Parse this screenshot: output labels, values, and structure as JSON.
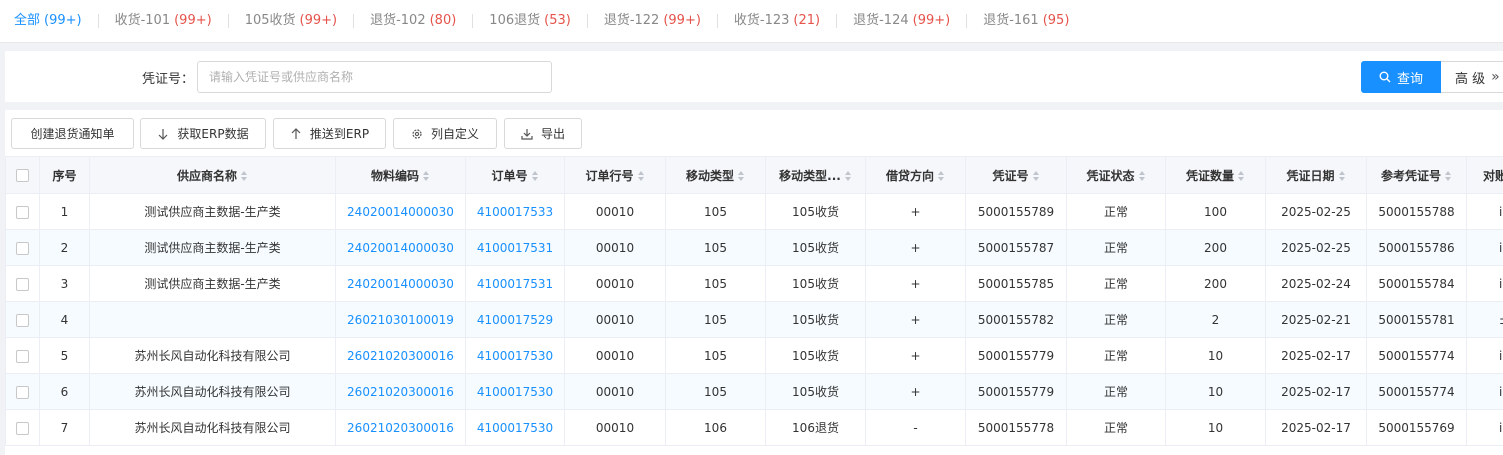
{
  "tabs": [
    {
      "label": "全部",
      "count": "(99+)",
      "active": true
    },
    {
      "label": "收货-101",
      "count": "(99+)"
    },
    {
      "label": "105收货",
      "count": "(99+)"
    },
    {
      "label": "退货-102",
      "count": "(80)"
    },
    {
      "label": "106退货",
      "count": "(53)"
    },
    {
      "label": "退货-122",
      "count": "(99+)"
    },
    {
      "label": "收货-123",
      "count": "(21)"
    },
    {
      "label": "退货-124",
      "count": "(99+)"
    },
    {
      "label": "退货-161",
      "count": "(95)"
    }
  ],
  "search": {
    "label": "凭证号：",
    "placeholder": "请输入凭证号或供应商名称",
    "value": "",
    "query_label": "查询",
    "advanced_label": "高 级",
    "advanced_chevron": "»"
  },
  "toolbar": {
    "create_label": "创建退货通知单",
    "fetch_label": "获取ERP数据",
    "push_label": "推送到ERP",
    "columns_label": "列自定义",
    "export_label": "导出"
  },
  "table": {
    "headers": {
      "index": "序号",
      "supplier": "供应商名称",
      "material": "物料编码",
      "order": "订单号",
      "order_line": "订单行号",
      "move_type": "移动类型",
      "move_type_desc": "移动类型...",
      "direction": "借贷方向",
      "voucher": "凭证号",
      "voucher_status": "凭证状态",
      "voucher_qty": "凭证数量",
      "voucher_date": "凭证日期",
      "ref_voucher": "参考凭证号",
      "last": "对账"
    },
    "rows": [
      {
        "index": "1",
        "supplier": "测试供应商主数据-生产类",
        "material": "24020014000030",
        "order": "4100017533",
        "order_line": "00010",
        "move_type": "105",
        "move_type_desc": "105收货",
        "direction": "+",
        "voucher": "5000155789",
        "voucher_status": "正常",
        "voucher_qty": "100",
        "voucher_date": "2025-02-25",
        "ref_voucher": "5000155788",
        "last": "i"
      },
      {
        "index": "2",
        "supplier": "测试供应商主数据-生产类",
        "material": "24020014000030",
        "order": "4100017531",
        "order_line": "00010",
        "move_type": "105",
        "move_type_desc": "105收货",
        "direction": "+",
        "voucher": "5000155787",
        "voucher_status": "正常",
        "voucher_qty": "200",
        "voucher_date": "2025-02-25",
        "ref_voucher": "5000155786",
        "last": "i"
      },
      {
        "index": "3",
        "supplier": "测试供应商主数据-生产类",
        "material": "24020014000030",
        "order": "4100017531",
        "order_line": "00010",
        "move_type": "105",
        "move_type_desc": "105收货",
        "direction": "+",
        "voucher": "5000155785",
        "voucher_status": "正常",
        "voucher_qty": "200",
        "voucher_date": "2025-02-24",
        "ref_voucher": "5000155784",
        "last": "i"
      },
      {
        "index": "4",
        "supplier": "",
        "material": "26021030100019",
        "order": "4100017529",
        "order_line": "00010",
        "move_type": "105",
        "move_type_desc": "105收货",
        "direction": "+",
        "voucher": "5000155782",
        "voucher_status": "正常",
        "voucher_qty": "2",
        "voucher_date": "2025-02-21",
        "ref_voucher": "5000155781",
        "last": "±"
      },
      {
        "index": "5",
        "supplier": "苏州长风自动化科技有限公司",
        "material": "26021020300016",
        "order": "4100017530",
        "order_line": "00010",
        "move_type": "105",
        "move_type_desc": "105收货",
        "direction": "+",
        "voucher": "5000155779",
        "voucher_status": "正常",
        "voucher_qty": "10",
        "voucher_date": "2025-02-17",
        "ref_voucher": "5000155774",
        "last": "i"
      },
      {
        "index": "6",
        "supplier": "苏州长风自动化科技有限公司",
        "material": "26021020300016",
        "order": "4100017530",
        "order_line": "00010",
        "move_type": "105",
        "move_type_desc": "105收货",
        "direction": "+",
        "voucher": "5000155779",
        "voucher_status": "正常",
        "voucher_qty": "10",
        "voucher_date": "2025-02-17",
        "ref_voucher": "5000155774",
        "last": "i"
      },
      {
        "index": "7",
        "supplier": "苏州长风自动化科技有限公司",
        "material": "26021020300016",
        "order": "4100017530",
        "order_line": "00010",
        "move_type": "106",
        "move_type_desc": "106退货",
        "direction": "-",
        "voucher": "5000155778",
        "voucher_status": "正常",
        "voucher_qty": "10",
        "voucher_date": "2025-02-17",
        "ref_voucher": "5000155769",
        "last": "i"
      }
    ]
  },
  "colors": {
    "accent": "#1890ff",
    "count_red": "#e5534b"
  },
  "icons": {
    "query": "search-icon",
    "fetch": "arrow-down-icon",
    "push": "arrow-up-icon",
    "columns": "gear-icon",
    "export": "download-icon"
  }
}
